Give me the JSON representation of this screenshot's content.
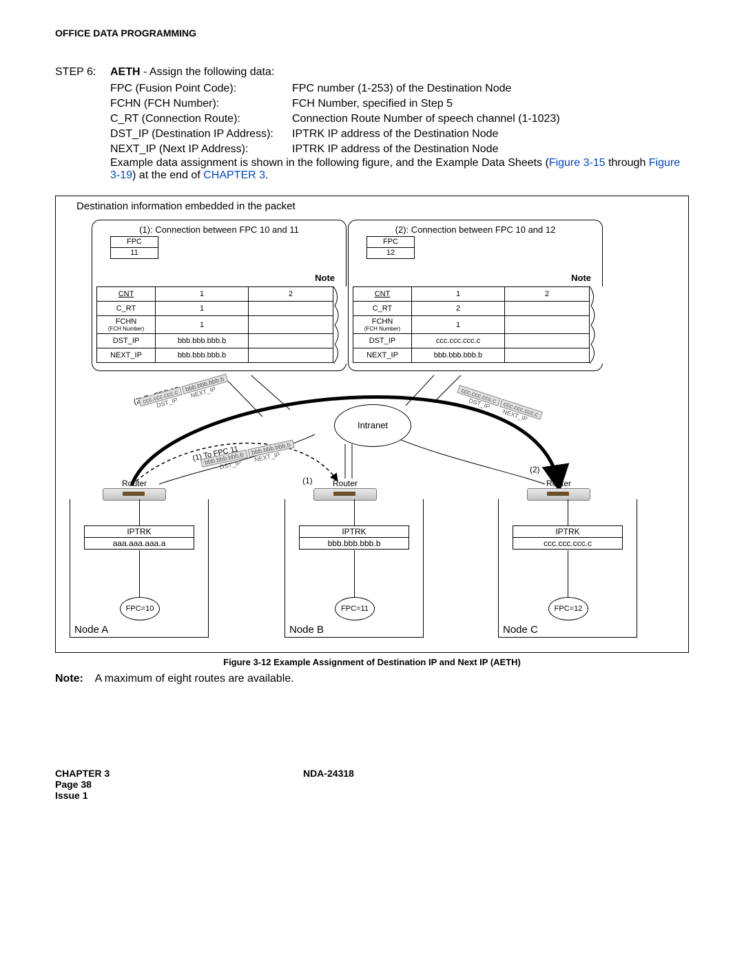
{
  "header": "OFFICE DATA PROGRAMMING",
  "step": {
    "label": "STEP 6:",
    "cmd": "AETH",
    "desc": " - Assign the following data:",
    "params": [
      {
        "name": "FPC (Fusion Point Code):",
        "val": "FPC number (1-253) of the Destination Node"
      },
      {
        "name": "FCHN (FCH Number):",
        "val": "FCH Number, specified in Step 5"
      },
      {
        "name": "C_RT (Connection Route):",
        "val": "Connection Route Number of speech channel (1-1023)"
      },
      {
        "name": "DST_IP (Destination IP Address):",
        "val": "IPTRK IP address of the Destination Node"
      },
      {
        "name": "NEXT_IP (Next IP Address):",
        "val": "IPTRK IP address of the Destination Node"
      }
    ],
    "example_pre": "Example data assignment is shown in the following figure, and the Example Data Sheets (",
    "link1": "Figure 3-15",
    "mid1": " through ",
    "link2": "Figure 3-19",
    "mid2": ") at the end of ",
    "link3": "CHAPTER 3",
    "end": "."
  },
  "diagram": {
    "title": "Destination information embedded in the packet",
    "callouts": [
      {
        "title": "(1): Connection between FPC 10 and 11",
        "fpc_label": "FPC",
        "fpc_val": "11",
        "note": "Note",
        "rows": {
          "cnt": "CNT",
          "cnt1": "1",
          "cnt2": "2",
          "crt": "C_RT",
          "crt1": "1",
          "fchn": "FCHN",
          "fchn_sub": "(FCH Number)",
          "fchn1": "1",
          "dst": "DST_IP",
          "dst1": "bbb.bbb.bbb.b",
          "nxt": "NEXT_IP",
          "nxt1": "bbb.bbb.bbb.b"
        }
      },
      {
        "title": "(2): Connection between FPC 10 and 12",
        "fpc_label": "FPC",
        "fpc_val": "12",
        "note": "Note",
        "rows": {
          "cnt": "CNT",
          "cnt1": "1",
          "cnt2": "2",
          "crt": "C_RT",
          "crt1": "2",
          "fchn": "FCHN",
          "fchn_sub": "(FCH Number)",
          "fchn1": "1",
          "dst": "DST_IP",
          "dst1": "ccc.ccc.ccc.c",
          "nxt": "NEXT_IP",
          "nxt1": "bbb.bbb.bbb.b"
        }
      }
    ],
    "intranet": "Intranet",
    "routers": {
      "a": "Router",
      "b": "Router",
      "c": "Router"
    },
    "nodes": [
      {
        "name": "Node A",
        "iptrk": "IPTRK",
        "ip": "aaa.aaa.aaa.a",
        "fpc": "FPC=10"
      },
      {
        "name": "Node B",
        "iptrk": "IPTRK",
        "ip": "bbb.bbb.bbb.b",
        "fpc": "FPC=11"
      },
      {
        "name": "Node C",
        "iptrk": "IPTRK",
        "ip": "ccc.ccc.ccc.c",
        "fpc": "FPC=12"
      }
    ],
    "route12_lbl": "(2) To FPC 12",
    "route12_tags": {
      "d": "ccc.ccc.ccc.c",
      "dl": "DST_IP",
      "n": "bbb.bbb.bbb.b",
      "nl": "NEXT_IP"
    },
    "route11_lbl": "(1) To FPC 11",
    "route11_tags": {
      "d": "bbb.bbb.bbb.b",
      "dl": "DST_IP",
      "n": "bbb.bbb.bbb.b",
      "nl": "NEXT_IP"
    },
    "route12r_tags": {
      "d": "ccc.ccc.ccc.c",
      "dl": "DST_IP",
      "n": "ccc.ccc.ccc.c",
      "nl": "NEXT_IP"
    },
    "num1": "(1)",
    "num2": "(2)",
    "caption": "Figure 3-12   Example Assignment of Destination IP and Next IP (AETH)"
  },
  "note": {
    "label": "Note:",
    "text": "A maximum of eight routes are available."
  },
  "footer": {
    "chapter": "CHAPTER 3",
    "doc": "NDA-24318",
    "page": "Page 38",
    "issue": "Issue 1"
  }
}
